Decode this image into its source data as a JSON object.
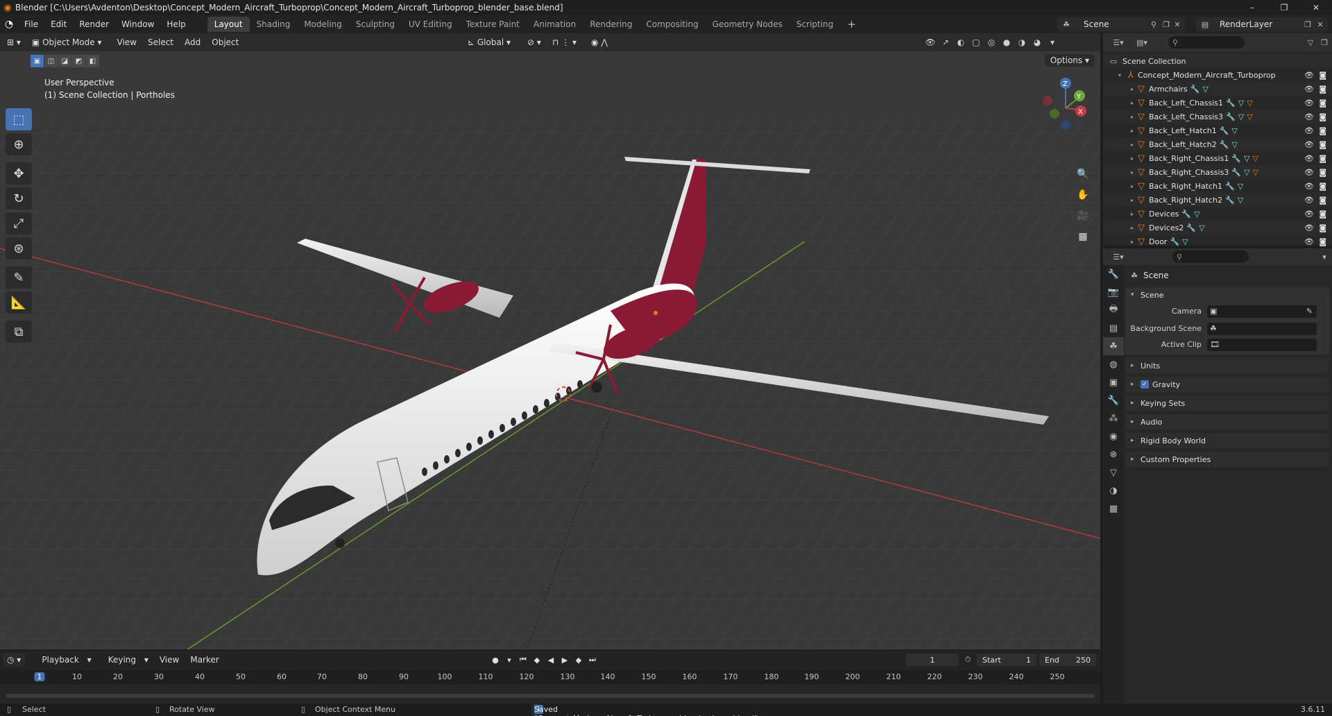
{
  "window": {
    "title": "Blender [C:\\Users\\Avdenton\\Desktop\\Concept_Modern_Aircraft_Turboprop\\Concept_Modern_Aircraft_Turboprop_blender_base.blend]",
    "minimize": "–",
    "maximize": "❐",
    "close": "✕"
  },
  "menu": [
    "File",
    "Edit",
    "Render",
    "Window",
    "Help"
  ],
  "workspaces": [
    "Layout",
    "Shading",
    "Modeling",
    "Sculpting",
    "UV Editing",
    "Texture Paint",
    "Animation",
    "Rendering",
    "Compositing",
    "Geometry Nodes",
    "Scripting"
  ],
  "active_workspace": "Layout",
  "scene_selector": "Scene",
  "render_layer": "RenderLayer",
  "viewport": {
    "mode": "Object Mode",
    "menu": [
      "View",
      "Select",
      "Add",
      "Object"
    ],
    "orientation": "Global",
    "perspective": "User Perspective",
    "collection_info": "(1) Scene Collection | Portholes",
    "options": "Options"
  },
  "outliner": {
    "root": "Scene Collection",
    "collection": "Concept_Modern_Aircraft_Turboprop",
    "items": [
      {
        "name": "Armchairs",
        "mat": false
      },
      {
        "name": "Back_Left_Chassis1",
        "mat": true
      },
      {
        "name": "Back_Left_Chassis3",
        "mat": true
      },
      {
        "name": "Back_Left_Hatch1",
        "mat": false
      },
      {
        "name": "Back_Left_Hatch2",
        "mat": false
      },
      {
        "name": "Back_Right_Chassis1",
        "mat": true
      },
      {
        "name": "Back_Right_Chassis3",
        "mat": true
      },
      {
        "name": "Back_Right_Hatch1",
        "mat": false
      },
      {
        "name": "Back_Right_Hatch2",
        "mat": false
      },
      {
        "name": "Devices",
        "mat": false
      },
      {
        "name": "Devices2",
        "mat": false
      },
      {
        "name": "Door",
        "mat": false
      }
    ]
  },
  "properties": {
    "context_title": "Scene",
    "panel_title": "Scene",
    "camera_label": "Camera",
    "background_label": "Background Scene",
    "clip_label": "Active Clip",
    "panels": [
      "Units",
      "Gravity",
      "Keying Sets",
      "Audio",
      "Rigid Body World",
      "Custom Properties"
    ]
  },
  "timeline": {
    "menu": [
      "Playback",
      "Keying",
      "View",
      "Marker"
    ],
    "current_frame": "1",
    "start_label": "Start",
    "start": "1",
    "end_label": "End",
    "end": "250",
    "ticks": [
      "1",
      "10",
      "20",
      "30",
      "40",
      "50",
      "60",
      "70",
      "80",
      "90",
      "100",
      "110",
      "120",
      "130",
      "140",
      "150",
      "160",
      "170",
      "180",
      "190",
      "200",
      "210",
      "220",
      "230",
      "240",
      "250"
    ]
  },
  "status": {
    "select": "Select",
    "rotate": "Rotate View",
    "context_menu": "Object Context Menu",
    "message": "Saved \"Concept_Modern_Aircraft_Turboprop_blender_base.blend\"",
    "version": "3.6.11"
  },
  "colors": {
    "accent": "#4772b3",
    "orange": "#e87d0d",
    "livery": "#8b1a34"
  }
}
